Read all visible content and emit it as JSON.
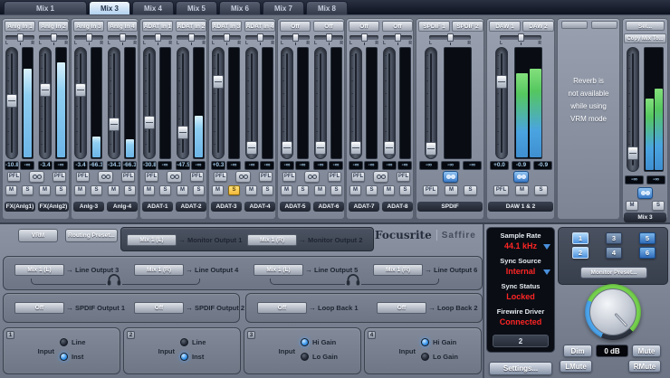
{
  "tabs": [
    {
      "label": "Mix 1",
      "active": false,
      "wide": true
    },
    {
      "label": "Mix 3",
      "active": true,
      "wide": false
    },
    {
      "label": "Mix 4",
      "active": false,
      "wide": false
    },
    {
      "label": "Mix 5",
      "active": false,
      "wide": false
    },
    {
      "label": "Mix 6",
      "active": false,
      "wide": false
    },
    {
      "label": "Mix 7",
      "active": false,
      "wide": false
    },
    {
      "label": "Mix 8",
      "active": false,
      "wide": false
    }
  ],
  "mixer": {
    "button_labels": {
      "pfl": "PFL",
      "mute": "M",
      "solo": "S"
    },
    "channels": [
      {
        "input": "Anlg In 1",
        "name": "FX(Anlg1)",
        "gain": "-10.8",
        "peak": "-∞",
        "fader": 48,
        "level": 80,
        "solo": false
      },
      {
        "input": "Anlg In 2",
        "name": "FX(Anlg2)",
        "gain": "-3.4",
        "peak": "-∞",
        "fader": 36,
        "level": 86,
        "solo": false
      },
      {
        "input": "Anlg In 3",
        "name": "Anlg-3",
        "gain": "-3.4",
        "peak": "-66.3",
        "fader": 36,
        "level": 19,
        "solo": false
      },
      {
        "input": "Anlg In 4",
        "name": "Anlg-4",
        "gain": "-34.3",
        "peak": "-66.3",
        "fader": 72,
        "level": 16,
        "solo": false
      },
      {
        "input": "ADAT In 1",
        "name": "ADAT-1",
        "gain": "-30.8",
        "peak": "-∞",
        "fader": 70,
        "level": 0,
        "solo": false
      },
      {
        "input": "ADAT In 2",
        "name": "ADAT-2",
        "gain": "-47.5",
        "peak": "-∞",
        "fader": 80,
        "level": 38,
        "solo": false
      },
      {
        "input": "ADAT In 3",
        "name": "ADAT-3",
        "gain": "+0.3",
        "peak": "-∞",
        "fader": 28,
        "level": 0,
        "solo": true
      },
      {
        "input": "ADAT In 4",
        "name": "ADAT-4",
        "gain": "-∞",
        "peak": "-∞",
        "fader": 96,
        "level": 0,
        "solo": false
      },
      {
        "input": "Off",
        "name": "ADAT-5",
        "gain": "-∞",
        "peak": "-∞",
        "fader": 96,
        "level": 0,
        "solo": false
      },
      {
        "input": "Off",
        "name": "ADAT-6",
        "gain": "-∞",
        "peak": "-∞",
        "fader": 96,
        "level": 0,
        "solo": false
      },
      {
        "input": "Off",
        "name": "ADAT-7",
        "gain": "-∞",
        "peak": "-∞",
        "fader": 96,
        "level": 0,
        "solo": false
      },
      {
        "input": "Off",
        "name": "ADAT-8",
        "gain": "-∞",
        "peak": "-∞",
        "fader": 96,
        "level": 0,
        "solo": false
      }
    ],
    "stereo_strips": [
      {
        "inputs": [
          "SPDIF 1",
          "SPDIF 2"
        ],
        "name": "SPDIF",
        "gain": "-∞",
        "peaks": [
          "-∞",
          "-∞"
        ],
        "fader": 97,
        "levels": [
          0,
          0
        ],
        "green": false
      },
      {
        "inputs": [
          "DAW 1",
          "DAW 2"
        ],
        "name": "DAW 1 & 2",
        "gain": "+0.0",
        "peaks": [
          "-0.9",
          "-0.9"
        ],
        "fader": 28,
        "levels": [
          76,
          80
        ],
        "green": true
      }
    ],
    "reverb_notice": [
      "Reverb is",
      "not available",
      "while using",
      "VRM mode"
    ],
    "master": {
      "sel": "Sel...",
      "copy": "Copy Mix To...",
      "gain": "-∞",
      "peak": "-∞",
      "name": "Mix 3",
      "fader": 90,
      "levels": [
        58,
        66
      ]
    }
  },
  "routing": {
    "vrm_label": "VRM",
    "preset_label": "Routing Preset...",
    "monitor_routes": [
      {
        "source": "Mix 1 (L)",
        "destination": "Monitor Output 1"
      },
      {
        "source": "Mix 1 (R)",
        "destination": "Monitor Output 2"
      }
    ],
    "line_routes": [
      {
        "source": "Mix 1 (L)",
        "destination": "Line Output 3"
      },
      {
        "source": "Mix 1 (R)",
        "destination": "Line Output 4"
      },
      {
        "source": "Mix 1 (L)",
        "destination": "Line Output 5"
      },
      {
        "source": "Mix 1 (R)",
        "destination": "Line Output 6"
      }
    ],
    "digital_routes": [
      {
        "source": "Off",
        "destination": "SPDIF Output 1"
      },
      {
        "source": "Off",
        "destination": "SPDIF Output 2"
      }
    ],
    "loopback_routes": [
      {
        "source": "Off",
        "destination": "Loop Back 1"
      },
      {
        "source": "Off",
        "destination": "Loop Back 2"
      }
    ],
    "input_boxes": [
      {
        "number": "1",
        "label": "Input",
        "options": [
          {
            "label": "Line",
            "selected": false
          },
          {
            "label": "Inst",
            "selected": true
          }
        ]
      },
      {
        "number": "2",
        "label": "Input",
        "options": [
          {
            "label": "Line",
            "selected": false
          },
          {
            "label": "Inst",
            "selected": true
          }
        ]
      },
      {
        "number": "3",
        "label": "Input",
        "options": [
          {
            "label": "Hi Gain",
            "selected": true
          },
          {
            "label": "Lo Gain",
            "selected": false
          }
        ]
      },
      {
        "number": "4",
        "label": "Input",
        "options": [
          {
            "label": "Hi Gain",
            "selected": true
          },
          {
            "label": "Lo Gain",
            "selected": false
          }
        ]
      }
    ]
  },
  "logo": {
    "brand": "Focusrite",
    "product": "Saffire"
  },
  "status": {
    "rows": [
      {
        "label": "Sample Rate",
        "value": "44.1 kHz",
        "dropdown": true
      },
      {
        "label": "Sync Source",
        "value": "Internal",
        "dropdown": true
      },
      {
        "label": "Sync Status",
        "value": "Locked",
        "dropdown": false
      },
      {
        "label": "Firewire Driver",
        "value": "Connected",
        "dropdown": false
      }
    ],
    "unit_display": "2",
    "settings_label": "Settings..."
  },
  "monitor": {
    "speaker_buttons": [
      {
        "label": "1",
        "state": "hi"
      },
      {
        "label": "2",
        "state": "hi"
      },
      {
        "label": "3",
        "state": "mid"
      },
      {
        "label": "4",
        "state": "mid"
      },
      {
        "label": "5",
        "state": "on"
      },
      {
        "label": "6",
        "state": "on"
      }
    ],
    "preset_label": "Monitor Preset...",
    "dim_label": "Dim",
    "level_display": "0 dB",
    "mute_label": "Mute",
    "lmute_label": "LMute",
    "rmute_label": "RMute"
  }
}
